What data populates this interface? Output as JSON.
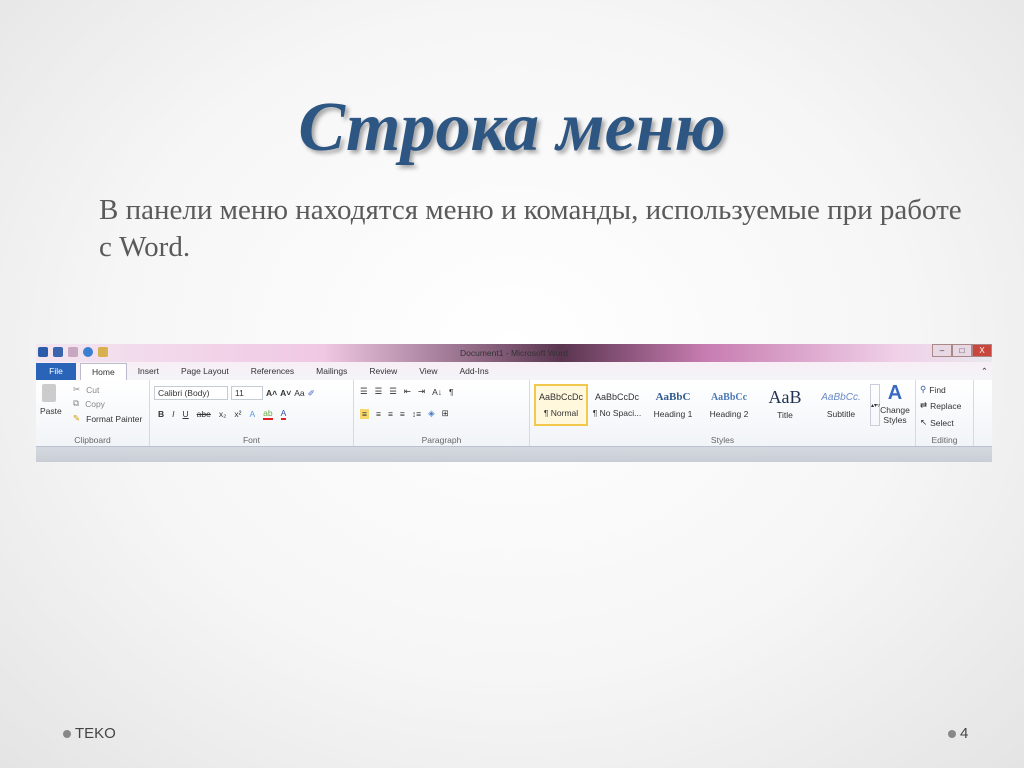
{
  "slide": {
    "title": "Строка меню",
    "body": "В панели меню находятся меню и команды, используемые при работе с Word.",
    "footer_left": "TEKO",
    "page_number": "4"
  },
  "word": {
    "window_title": "Document1 - Microsoft Word",
    "window_buttons": {
      "minimize": "–",
      "restore": "□",
      "close": "X"
    },
    "tabs": [
      "File",
      "Home",
      "Insert",
      "Page Layout",
      "References",
      "Mailings",
      "Review",
      "View",
      "Add-Ins"
    ],
    "active_tab": "Home",
    "clipboard": {
      "paste": "Paste",
      "cut": "Cut",
      "copy": "Copy",
      "format_painter": "Format Painter",
      "label": "Clipboard"
    },
    "font": {
      "font_name": "Calibri (Body)",
      "font_size": "11",
      "grow": "A˄",
      "shrink": "A˅",
      "change_case": "Aa",
      "bold": "B",
      "italic": "I",
      "underline": "U",
      "strike": "abe",
      "subscript": "x₂",
      "superscript": "x²",
      "label": "Font"
    },
    "paragraph": {
      "sort": "A↓",
      "pilcrow": "¶",
      "label": "Paragraph"
    },
    "styles": {
      "items": [
        {
          "preview": "AaBbCcDc",
          "name": "¶ Normal"
        },
        {
          "preview": "AaBbCcDc",
          "name": "¶ No Spaci..."
        },
        {
          "preview": "AaBbC",
          "name": "Heading 1"
        },
        {
          "preview": "AaBbCc",
          "name": "Heading 2"
        },
        {
          "preview": "AaB",
          "name": "Title"
        },
        {
          "preview": "AaBbCc.",
          "name": "Subtitle"
        }
      ],
      "change_styles": "Change Styles",
      "label": "Styles"
    },
    "editing": {
      "find": "Find",
      "replace": "Replace",
      "select": "Select",
      "label": "Editing"
    },
    "colors": {
      "file_tab": "#2a64b8",
      "highlight": "#f2c94c",
      "title": "#2d5683"
    }
  }
}
